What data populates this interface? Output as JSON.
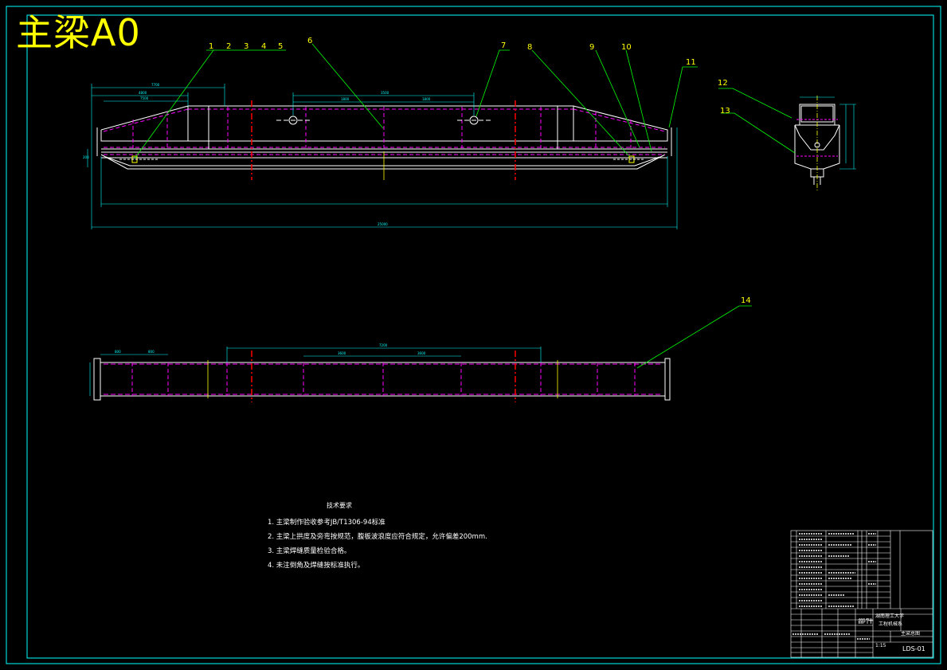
{
  "header": {
    "stamp": "主梁A0"
  },
  "callouts": [
    "1",
    "2",
    "3",
    "4",
    "5",
    "6",
    "7",
    "8",
    "9",
    "10",
    "11",
    "12",
    "13",
    "14"
  ],
  "notes": {
    "title": "技术要求",
    "items": [
      "1. 主梁制作验收参考JB/T1306-94标准",
      "2. 主梁上拱度及旁弯按规范，腹板波浪度应符合规定，允许偏差200mm.",
      "3. 主梁焊缝质量检验合格。",
      "4. 未注倒角及焊缝按标准执行。"
    ]
  },
  "title_block": {
    "drawing_title": "部件",
    "school": "湖南理工大学",
    "school_sub": "工程机械系",
    "part_name": "主梁总图",
    "drawing_no": "LDS-01",
    "scale": "1:15"
  },
  "colors": {
    "frame": "#00ffff",
    "outline": "#ffffff",
    "hidden": "#ff00ff",
    "center": "#ff0000",
    "leader": "#00ff00",
    "label": "#ffff00",
    "dimension": "#00ffff"
  }
}
